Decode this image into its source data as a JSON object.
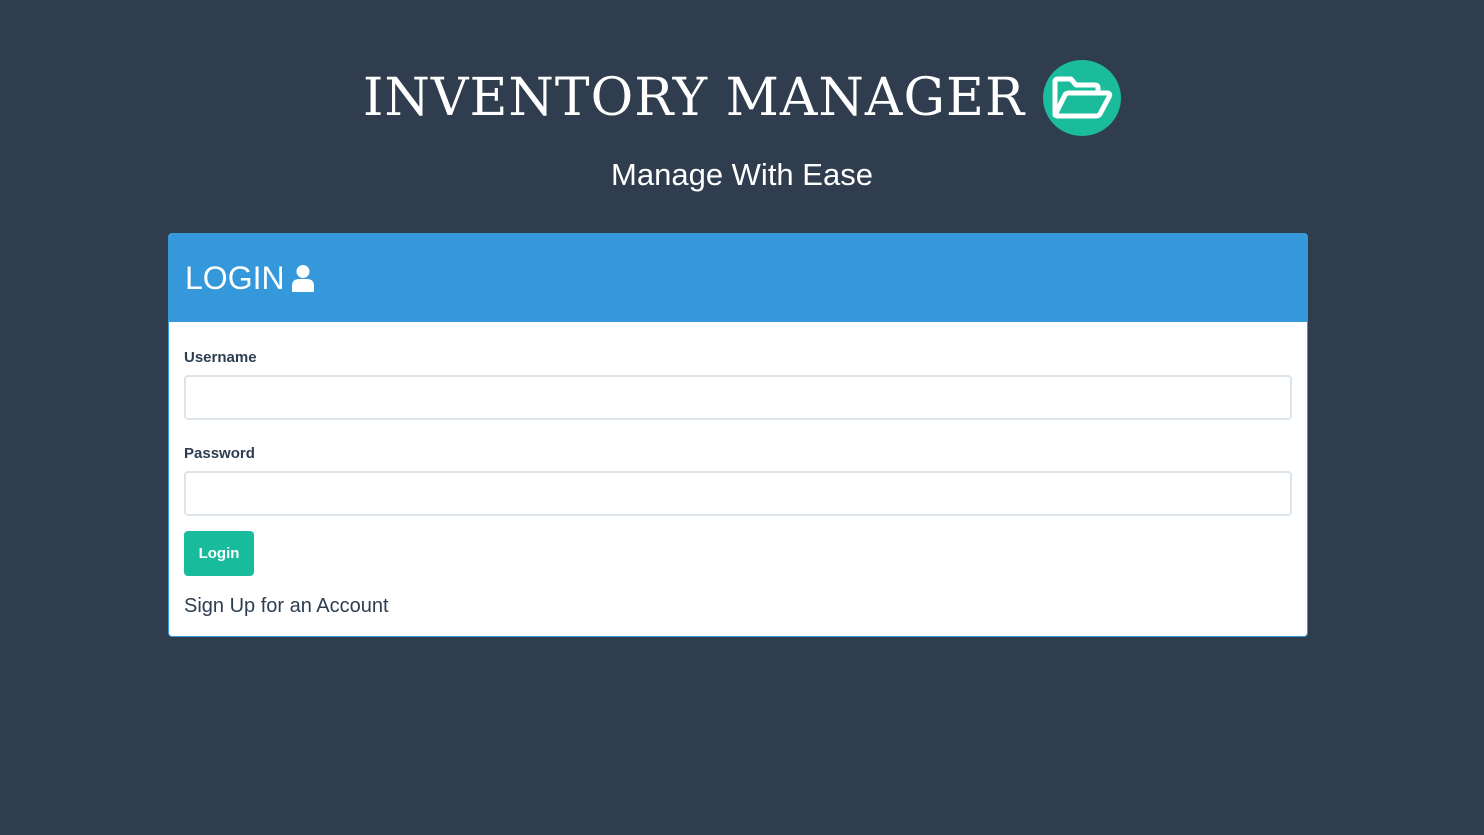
{
  "header": {
    "app_title": "INVENTORY MANAGER",
    "logo_icon": "folder-open-icon",
    "tagline": "Manage With Ease"
  },
  "login_panel": {
    "title": "LOGIN",
    "title_icon": "user-icon",
    "username": {
      "label": "Username",
      "value": "",
      "placeholder": ""
    },
    "password": {
      "label": "Password",
      "value": "",
      "placeholder": ""
    },
    "login_button_label": "Login",
    "signup_link_label": "Sign Up for an Account"
  },
  "colors": {
    "background": "#2f3d4e",
    "accent_teal": "#18bc9c",
    "panel_header_blue": "#3498db",
    "text_dark": "#2c3e50"
  }
}
